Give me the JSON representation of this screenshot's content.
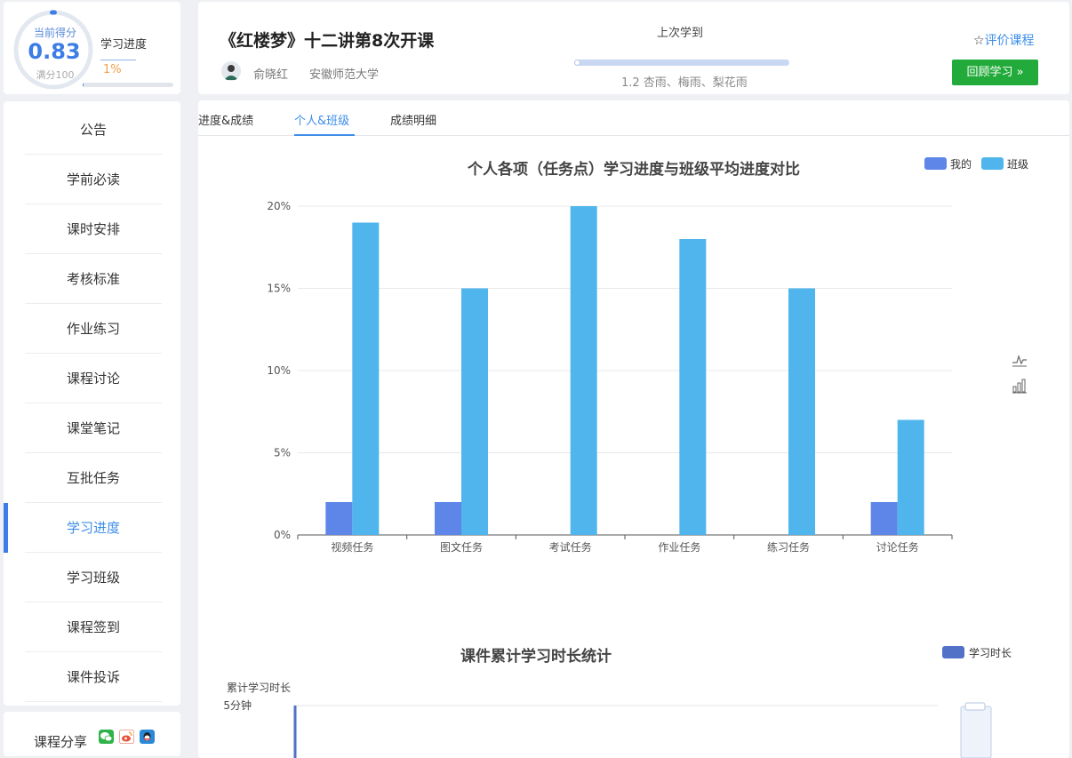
{
  "score": {
    "label": "当前得分",
    "value": "0.83",
    "max": "满分100"
  },
  "progress": {
    "title": "学习进度",
    "value": "1%",
    "fraction": 0.01
  },
  "nav": {
    "items": [
      {
        "label": "公告"
      },
      {
        "label": "学前必读"
      },
      {
        "label": "课时安排"
      },
      {
        "label": "考核标准"
      },
      {
        "label": "作业练习"
      },
      {
        "label": "课程讨论"
      },
      {
        "label": "课堂笔记"
      },
      {
        "label": "互批任务"
      },
      {
        "label": "学习进度",
        "active": true
      },
      {
        "label": "学习班级"
      },
      {
        "label": "课程签到"
      },
      {
        "label": "课件投诉"
      }
    ]
  },
  "share": {
    "label": "课程分享",
    "icons": [
      "wechat-icon",
      "weibo-icon",
      "qq-icon"
    ]
  },
  "header": {
    "title": "《红楼梦》十二讲第8次开课",
    "teacher": "俞晓红",
    "school": "安徽师范大学",
    "last_label": "上次学到",
    "last_chapter": "1.2 杏雨、梅雨、梨花雨",
    "rate_label": "评价课程",
    "review_label": "回顾学习 »"
  },
  "tabs": [
    {
      "label": "进度&成绩"
    },
    {
      "label": "个人&班级",
      "active": true
    },
    {
      "label": "成绩明细"
    }
  ],
  "colors": {
    "mine": "#5d86e8",
    "class": "#4fb5ec",
    "duration": "#5272c8",
    "accent": "#3c8ee8",
    "button": "#22ab3a"
  },
  "chart_data": [
    {
      "type": "bar",
      "title": "个人各项（任务点）学习进度与班级平均进度对比",
      "categories": [
        "视频任务",
        "图文任务",
        "考试任务",
        "作业任务",
        "练习任务",
        "讨论任务"
      ],
      "series": [
        {
          "name": "我的",
          "values": [
            2,
            2,
            0,
            0,
            0,
            2
          ]
        },
        {
          "name": "班级",
          "values": [
            19,
            15,
            20,
            18,
            15,
            7
          ]
        }
      ],
      "yticks": [
        "0%",
        "5%",
        "10%",
        "15%",
        "20%"
      ],
      "ylim": [
        0,
        20
      ],
      "legend": "top-right",
      "grid": true
    },
    {
      "type": "bar",
      "title": "课件累计学习时长统计",
      "ylabel": "累计学习时长",
      "series": [
        {
          "name": "学习时长"
        }
      ],
      "yticks": [
        "5分钟"
      ],
      "legend": "top-right",
      "grid": true
    }
  ]
}
